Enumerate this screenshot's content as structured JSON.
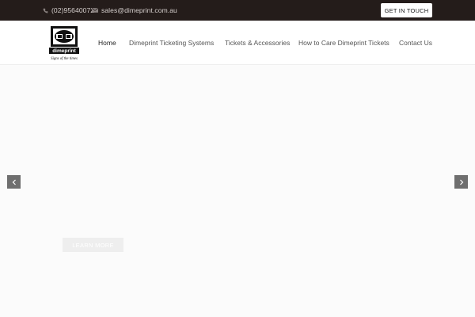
{
  "topbar": {
    "phone": "(02)95640072",
    "email": "sales@dimeprint.com.au",
    "cta_label": "GET IN TOUCH"
  },
  "logo": {
    "brand": "dimeprint",
    "tagline": "Signs of the times"
  },
  "nav": {
    "items": [
      {
        "label": "Home",
        "active": true
      },
      {
        "label": "Dimeprint Ticketing Systems",
        "active": false
      },
      {
        "label": "Tickets & Accessories",
        "active": false
      },
      {
        "label": "How to Care Dimeprint Tickets",
        "active": false
      },
      {
        "label": "Contact Us",
        "active": false
      }
    ]
  },
  "hero": {
    "button_label": "LEARN MORE",
    "prev_icon": "chevron-left-icon",
    "next_icon": "chevron-right-icon"
  },
  "colors": {
    "topbar_bg": "#241c1a",
    "hero_bg": "#fbfbfb",
    "arrow_bg": "#6f6f6f"
  }
}
